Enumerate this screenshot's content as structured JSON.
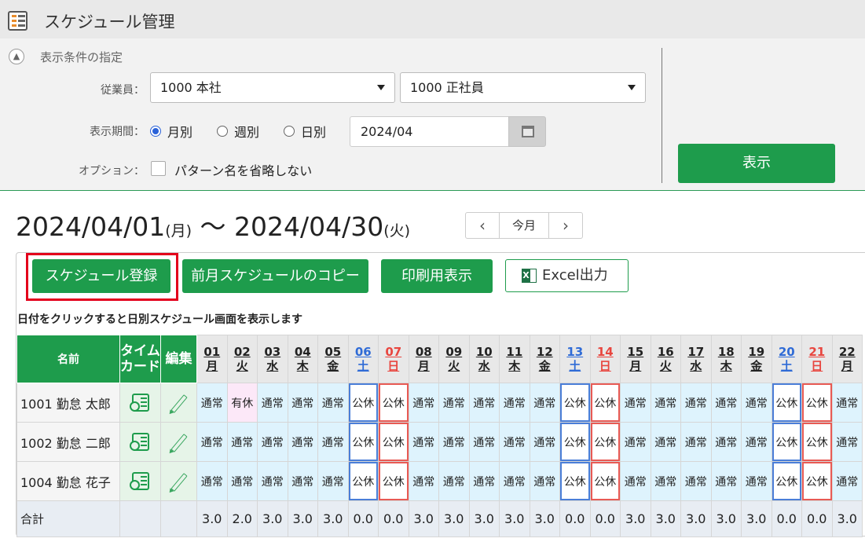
{
  "app": {
    "title": "スケジュール管理",
    "icon": "schedule-list-icon"
  },
  "filter": {
    "heading": "表示条件の指定",
    "employee_label": "従業員：",
    "employee_select1": "1000 本社",
    "employee_select2": "1000 正社員",
    "period_label": "表示期間：",
    "period_options": [
      "月別",
      "週別",
      "日別"
    ],
    "period_selected": "月別",
    "period_value": "2024/04",
    "option_label": "オプション：",
    "option_checkbox": "パターン名を省略しない",
    "option_checked": false,
    "show_button": "表示"
  },
  "range": {
    "start": "2024/04/01",
    "start_dow": "(月)",
    "separator": "〜",
    "end": "2024/04/30",
    "end_dow": "(火)"
  },
  "nav": {
    "prev": "‹",
    "today": "今月",
    "next": "›"
  },
  "toolbar": {
    "register": "スケジュール登録",
    "copy_prev": "前月スケジュールのコピー",
    "print": "印刷用表示",
    "excel": "Excel出力"
  },
  "hint": "日付をクリックすると日別スケジュール画面を表示します",
  "table": {
    "headers": {
      "name": "名前",
      "timecard1": "タイム",
      "timecard2": "カード",
      "edit": "編集"
    },
    "days": [
      {
        "d": "01",
        "w": "月",
        "t": "wd"
      },
      {
        "d": "02",
        "w": "火",
        "t": "wd"
      },
      {
        "d": "03",
        "w": "水",
        "t": "wd"
      },
      {
        "d": "04",
        "w": "木",
        "t": "wd"
      },
      {
        "d": "05",
        "w": "金",
        "t": "wd"
      },
      {
        "d": "06",
        "w": "土",
        "t": "sat"
      },
      {
        "d": "07",
        "w": "日",
        "t": "sun"
      },
      {
        "d": "08",
        "w": "月",
        "t": "wd"
      },
      {
        "d": "09",
        "w": "火",
        "t": "wd"
      },
      {
        "d": "10",
        "w": "水",
        "t": "wd"
      },
      {
        "d": "11",
        "w": "木",
        "t": "wd"
      },
      {
        "d": "12",
        "w": "金",
        "t": "wd"
      },
      {
        "d": "13",
        "w": "土",
        "t": "sat"
      },
      {
        "d": "14",
        "w": "日",
        "t": "sun"
      },
      {
        "d": "15",
        "w": "月",
        "t": "wd"
      },
      {
        "d": "16",
        "w": "火",
        "t": "wd"
      },
      {
        "d": "17",
        "w": "水",
        "t": "wd"
      },
      {
        "d": "18",
        "w": "木",
        "t": "wd"
      },
      {
        "d": "19",
        "w": "金",
        "t": "wd"
      },
      {
        "d": "20",
        "w": "土",
        "t": "sat"
      },
      {
        "d": "21",
        "w": "日",
        "t": "sun"
      },
      {
        "d": "22",
        "w": "月",
        "t": "wd"
      }
    ],
    "rows": [
      {
        "name": "1001 勤怠 太郎",
        "cells": [
          "通常",
          "有休",
          "通常",
          "通常",
          "通常",
          "公休",
          "公休",
          "通常",
          "通常",
          "通常",
          "通常",
          "通常",
          "公休",
          "公休",
          "通常",
          "通常",
          "通常",
          "通常",
          "通常",
          "公休",
          "公休",
          "通常"
        ]
      },
      {
        "name": "1002 勤怠 二郎",
        "cells": [
          "通常",
          "通常",
          "通常",
          "通常",
          "通常",
          "公休",
          "公休",
          "通常",
          "通常",
          "通常",
          "通常",
          "通常",
          "公休",
          "公休",
          "通常",
          "通常",
          "通常",
          "通常",
          "通常",
          "公休",
          "公休",
          "通常"
        ]
      },
      {
        "name": "1004 勤怠 花子",
        "cells": [
          "通常",
          "通常",
          "通常",
          "通常",
          "通常",
          "公休",
          "公休",
          "通常",
          "通常",
          "通常",
          "通常",
          "通常",
          "公休",
          "公休",
          "通常",
          "通常",
          "通常",
          "通常",
          "通常",
          "公休",
          "公休",
          "通常"
        ]
      }
    ],
    "total_label": "合計",
    "totals": [
      "3.0",
      "2.0",
      "3.0",
      "3.0",
      "3.0",
      "0.0",
      "0.0",
      "3.0",
      "3.0",
      "3.0",
      "3.0",
      "3.0",
      "0.0",
      "0.0",
      "3.0",
      "3.0",
      "3.0",
      "3.0",
      "3.0",
      "0.0",
      "0.0",
      "3.0"
    ]
  }
}
